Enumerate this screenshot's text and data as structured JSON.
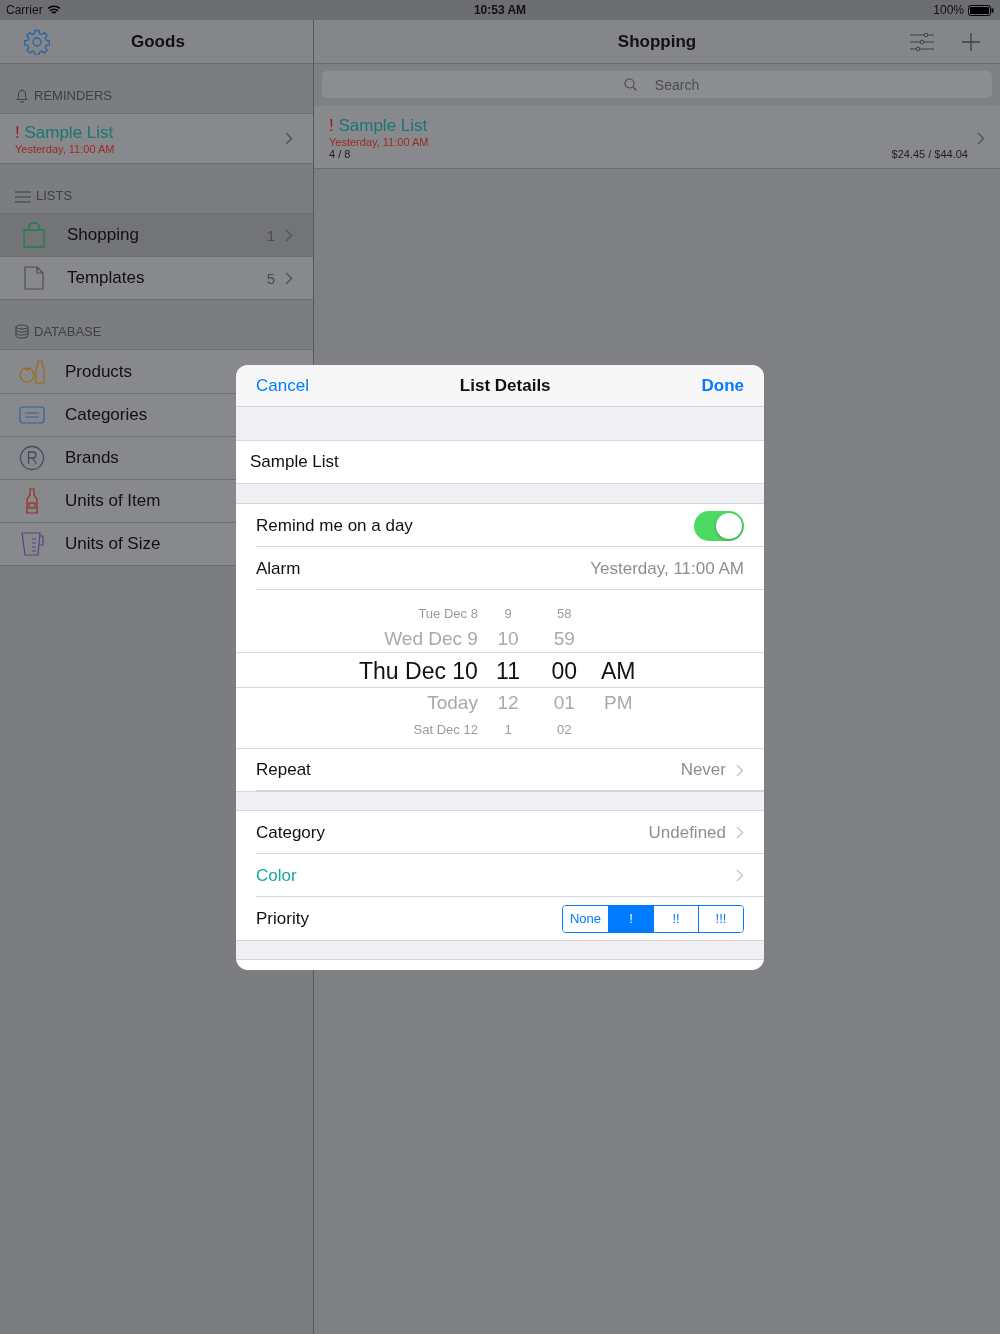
{
  "status_bar": {
    "carrier": "Carrier",
    "time": "10:53 AM",
    "battery": "100%"
  },
  "sidebar": {
    "title": "Goods",
    "reminders": {
      "header": "REMINDERS",
      "items": [
        {
          "priority": "!",
          "name": "Sample List",
          "due": "Yesterday, 11:00 AM"
        }
      ]
    },
    "lists": {
      "header": "LISTS",
      "items": [
        {
          "kind": "bag",
          "name": "Shopping",
          "count": "1",
          "selected": true
        },
        {
          "kind": "document",
          "name": "Templates",
          "count": "5",
          "selected": false
        }
      ]
    },
    "database": {
      "header": "DATABASE",
      "items": [
        {
          "kind": "products",
          "name": "Products"
        },
        {
          "kind": "categories",
          "name": "Categories"
        },
        {
          "kind": "brands",
          "name": "Brands"
        },
        {
          "kind": "bottle",
          "name": "Units of Item"
        },
        {
          "kind": "cup",
          "name": "Units of Size"
        }
      ]
    }
  },
  "detail": {
    "title": "Shopping",
    "search": {
      "placeholder": "Search"
    },
    "lists": [
      {
        "priority": "!",
        "name": "Sample List",
        "due": "Yesterday, 11:00 AM",
        "progress": "4 / 8",
        "amount": "$24.45 / $44.04"
      }
    ]
  },
  "dialog": {
    "title": "List Details",
    "cancel": "Cancel",
    "done": "Done",
    "name_field": {
      "value": "Sample List"
    },
    "remind": {
      "label": "Remind me on a day",
      "on": true
    },
    "alarm": {
      "label": "Alarm",
      "value": "Yesterday, 11:00 AM"
    },
    "picker": {
      "columns": [
        {
          "kind": "date",
          "items": [
            {
              "text": "Tue Dec 8",
              "selected": false
            },
            {
              "text": "Wed Dec 9",
              "selected": false
            },
            {
              "text": "Thu Dec 10",
              "selected": true
            },
            {
              "text": "Today",
              "selected": false
            },
            {
              "text": "Sat Dec 12",
              "selected": false
            }
          ]
        },
        {
          "kind": "hour",
          "items": [
            {
              "text": "9",
              "selected": false
            },
            {
              "text": "10",
              "selected": false
            },
            {
              "text": "11",
              "selected": true
            },
            {
              "text": "12",
              "selected": false
            },
            {
              "text": "1",
              "selected": false
            }
          ]
        },
        {
          "kind": "minute",
          "items": [
            {
              "text": "58",
              "selected": false
            },
            {
              "text": "59",
              "selected": false
            },
            {
              "text": "00",
              "selected": true
            },
            {
              "text": "01",
              "selected": false
            },
            {
              "text": "02",
              "selected": false
            }
          ]
        },
        {
          "kind": "ampm",
          "items": [
            {
              "text": "AM",
              "selected": true
            },
            {
              "text": "PM",
              "selected": false
            }
          ]
        }
      ]
    },
    "repeat": {
      "label": "Repeat",
      "value": "Never"
    },
    "category": {
      "label": "Category",
      "value": "Undefined"
    },
    "color": {
      "label": "Color"
    },
    "priority": {
      "label": "Priority",
      "options": [
        {
          "label": "None",
          "selected": false
        },
        {
          "label": "!",
          "selected": true
        },
        {
          "label": "!!",
          "selected": false
        },
        {
          "label": "!!!",
          "selected": false
        }
      ]
    }
  }
}
